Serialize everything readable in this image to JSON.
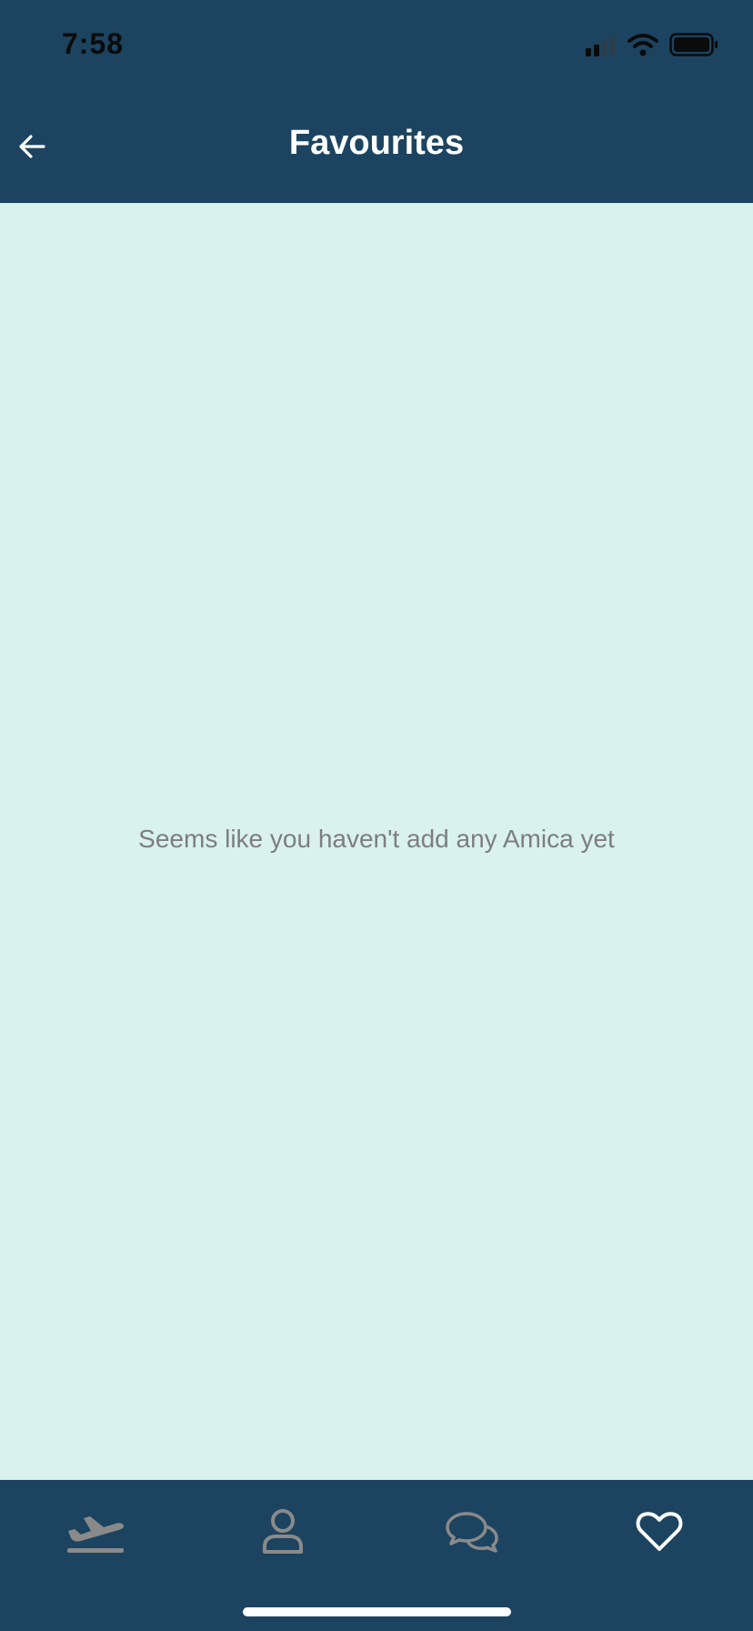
{
  "status_bar": {
    "time": "7:58",
    "icons": [
      "cellular-signal-icon",
      "wifi-icon",
      "battery-icon"
    ]
  },
  "header": {
    "title": "Favourites",
    "back_icon": "arrow-left-icon"
  },
  "main": {
    "empty_message": "Seems like you haven't add any Amica yet"
  },
  "tabbar": {
    "items": [
      {
        "icon": "airplane-takeoff-icon",
        "active": false
      },
      {
        "icon": "user-icon",
        "active": false
      },
      {
        "icon": "chat-bubbles-icon",
        "active": false
      },
      {
        "icon": "heart-icon",
        "active": true
      }
    ]
  },
  "colors": {
    "header_background": "#1c4460",
    "content_background": "#d9f2ec",
    "active_icon": "#ffffff",
    "inactive_icon": "#8a8a8a",
    "message_text": "#7e7e7e"
  }
}
